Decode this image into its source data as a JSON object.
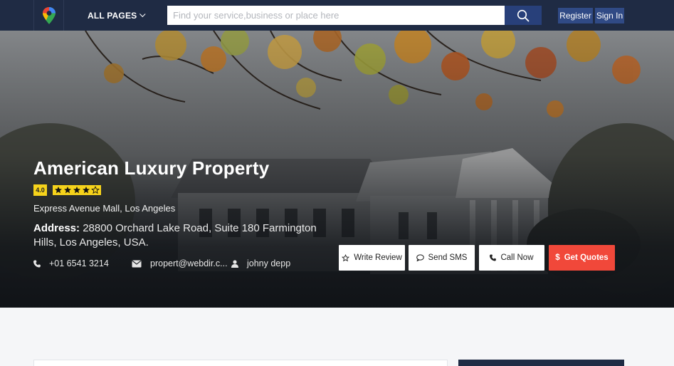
{
  "header": {
    "nav_label": "ALL PAGES",
    "search_placeholder": "Find your service,business or place here",
    "register_label": "Register",
    "signin_label": "Sign In"
  },
  "listing": {
    "title": "American Luxury Property",
    "rating": "4.0",
    "stars": 5,
    "location": "Express Avenue Mall, Los Angeles",
    "address_label": "Address:",
    "address": "28800 Orchard Lake Road, Suite 180 Farmington Hills, Los Angeles, USA.",
    "phone": "+01 6541 3214",
    "email": "propert@webdir.c...",
    "owner": "johny depp"
  },
  "actions": {
    "write_review": "Write Review",
    "send_sms": "Send SMS",
    "call_now": "Call Now",
    "get_quotes": "Get Quotes"
  },
  "colors": {
    "header_bg": "#1f2b44",
    "accent_blue": "#304a85",
    "star_yellow": "#f6d31b",
    "quote_red": "#f1483a"
  },
  "icons": [
    "map-pin-logo-icon",
    "chevron-down-icon",
    "search-icon",
    "star-icon",
    "comment-icon",
    "phone-icon",
    "dollar-icon",
    "envelope-icon",
    "user-icon"
  ]
}
